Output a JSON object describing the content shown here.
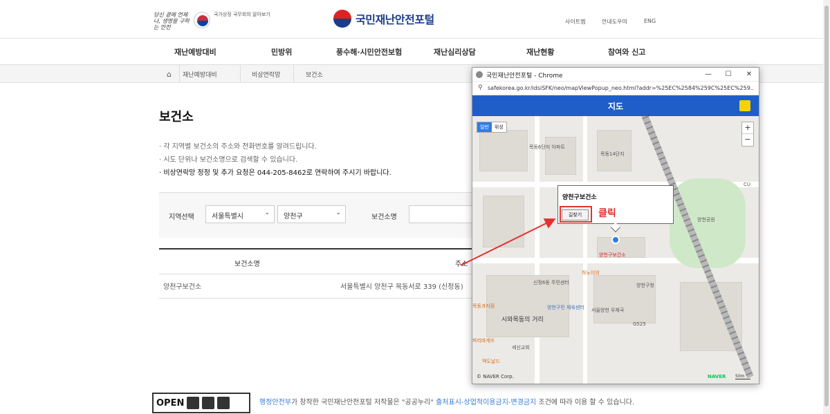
{
  "header": {
    "slogan": "당신 곁에 언제나, 생명을 구하는 안전",
    "gov_text": "국가상징 국무회의 알아보기",
    "logo_text": "국민재난안전포털",
    "util": [
      "사이트맵",
      "안내도우미",
      "ENG"
    ]
  },
  "gnb": [
    "재난예방대비",
    "민방위",
    "풍수해·시민안전보험",
    "재난심리상담",
    "재난현황",
    "참여와 신고"
  ],
  "breadcrumb": [
    "재난예방대비",
    "비상연락망",
    "보건소"
  ],
  "page": {
    "title": "보건소",
    "desc": [
      "· 각 지역별 보건소의 주소와 전화번호를 알려드립니다.",
      "· 시도 단위나 보건소명으로 검색할 수 있습니다.",
      "· 비상연락망 정정 및 추가 요청은 044-205-8462로 연락하여 주시기 바랍니다."
    ]
  },
  "search": {
    "region_label": "지역선택",
    "sido": "서울특별시",
    "sigungu": "양천구",
    "name_label": "보건소명",
    "name_value": ""
  },
  "table": {
    "headers": [
      "보건소명",
      "주소"
    ],
    "rows": [
      [
        "양천구보건소",
        "서울특별시 양천구 목동서로 339 (신정동)"
      ]
    ]
  },
  "footer": {
    "open": "OPEN",
    "license_org": "행정안전부",
    "license_mid": "가 창작한 국민재난안전포털 저작물은 \"공공누리\" ",
    "license_link": "출처표시-상업적이용금지-변경금지",
    "license_end": " 조건에 따라 이용 할 수 있습니다."
  },
  "popup": {
    "window_title": "국민재난안전포털 - Chrome",
    "url": "safekorea.go.kr/idsiSFK/neo/mapViewPopup_neo.html?addr=%25EC%2584%259C%25EC%259...",
    "header_title": "지도",
    "map_types": [
      "일반",
      "위성"
    ],
    "zoom": [
      "+",
      "−"
    ],
    "info_name": "양천구보건소",
    "info_button": "길찾기",
    "annotation": "클릭",
    "marker_label": "양천구보건소",
    "copyright": "© NAVER Corp.",
    "naver": "NAVER",
    "scale": "50m",
    "pois": [
      "목동6단지 아파트",
      "목동14단지",
      "양천공원",
      "신정6동 주민센터",
      "양천구민 체육센터",
      "서울양천 우체국",
      "양천구청",
      "시와목동의 거리",
      "세신교회",
      "파리바게뜨",
      "맥도날드",
      "목동과자점",
      "하노이의",
      "CU",
      "G525"
    ]
  },
  "colors": {
    "brand": "#1b3d8c",
    "popup_header": "#1f5ec9",
    "annotation": "#e53030"
  }
}
